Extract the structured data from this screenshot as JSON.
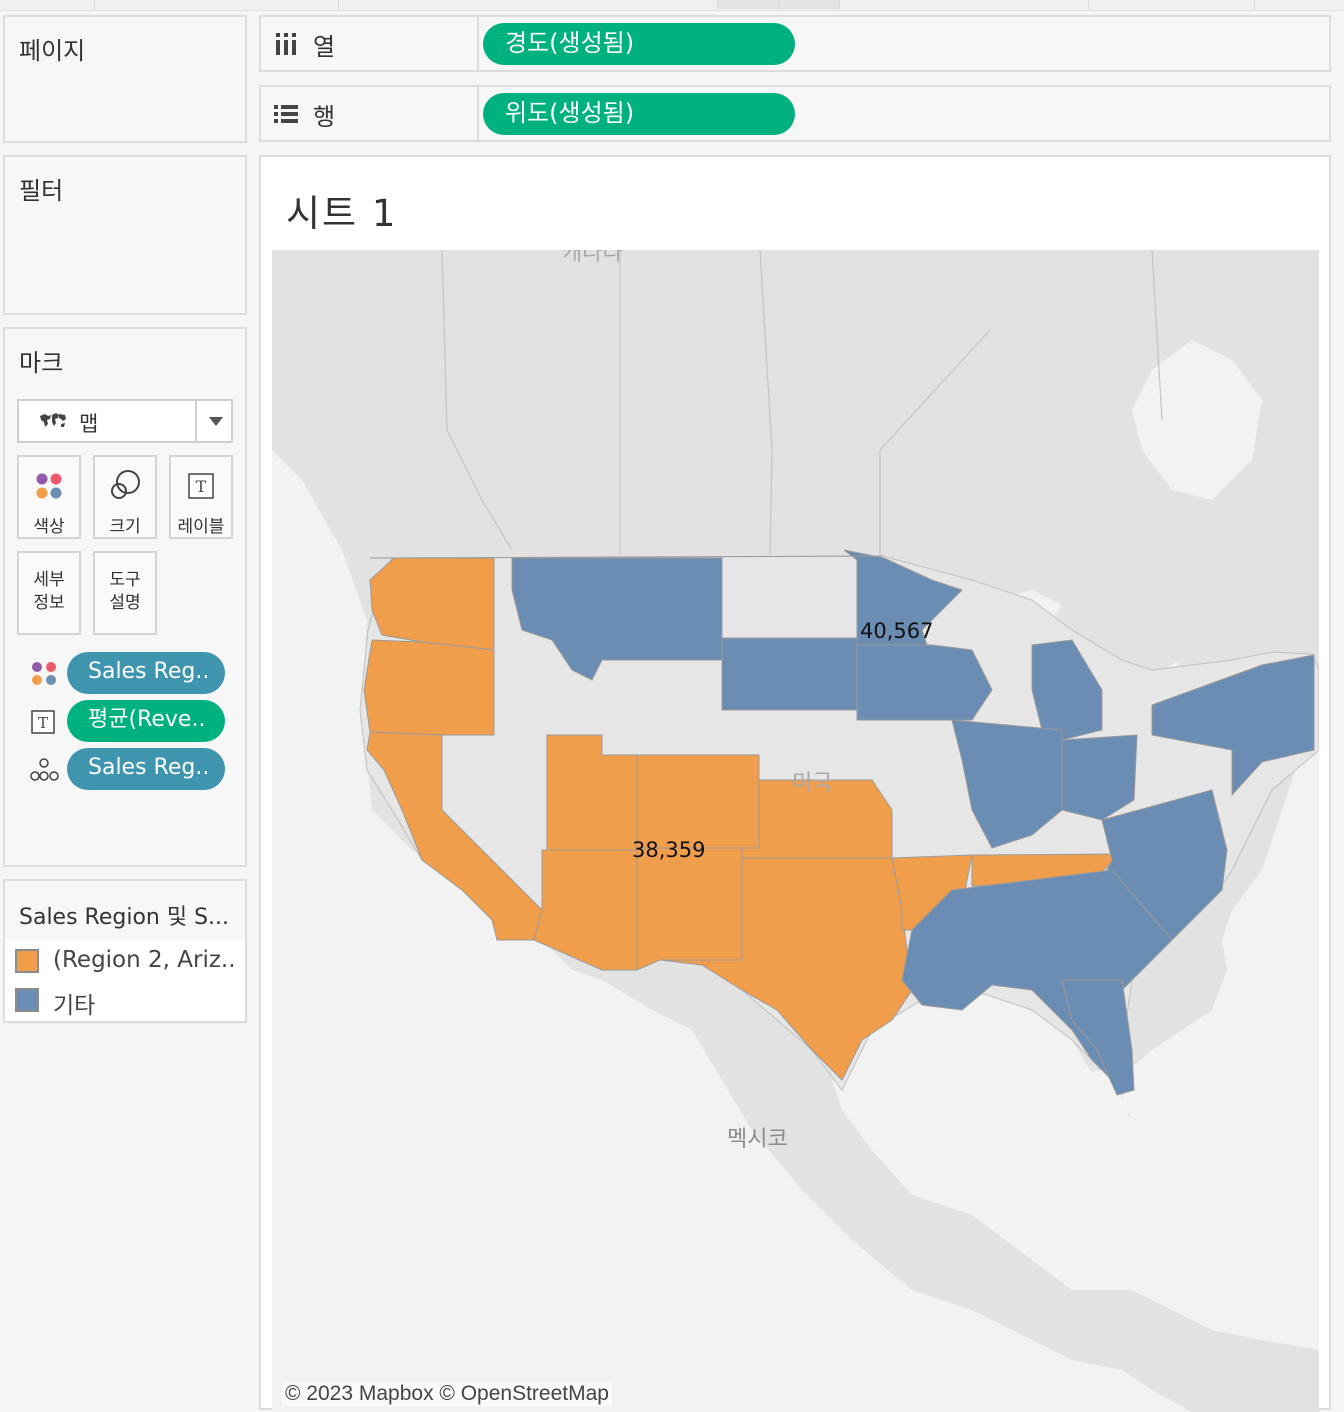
{
  "shelves": {
    "columns": {
      "label": "열",
      "pill": "경도(생성됨)"
    },
    "rows": {
      "label": "행",
      "pill": "위도(생성됨)"
    }
  },
  "cards": {
    "pages": "페이지",
    "filters": "필터",
    "marks": "마크"
  },
  "marks": {
    "type": "맵",
    "buttons": {
      "color": "색상",
      "size": "크기",
      "label": "레이블",
      "detail_1": "세부",
      "detail_2": "정보",
      "tooltip_1": "도구",
      "tooltip_2": "설명"
    },
    "pills": [
      {
        "icon": "color-icon",
        "text": "Sales Reg.."
      },
      {
        "icon": "label-icon",
        "text": "평균(Reve.."
      },
      {
        "icon": "detail-icon",
        "text": "Sales Reg.."
      }
    ]
  },
  "legend": {
    "title": "Sales Region 및 S...",
    "items": [
      {
        "label": "(Region 2, Ariz..",
        "color": "#f19e4c"
      },
      {
        "label": "기타",
        "color": "#6b8db3"
      }
    ]
  },
  "sheet": {
    "title": "시트 1",
    "map_labels": {
      "canada": "캐나다",
      "usa": "미국",
      "mexico": "멕시코"
    },
    "data_labels": {
      "region_blue": "40,567",
      "region_orange": "38,359"
    },
    "attribution": "© 2023 Mapbox © OpenStreetMap"
  },
  "colors": {
    "orange": "#f19e4c",
    "blue": "#6b8db3",
    "pill_green": "#00b180",
    "pill_blue": "#3f95ad",
    "land": "#e2e2e2",
    "water": "#f2f2f2"
  }
}
